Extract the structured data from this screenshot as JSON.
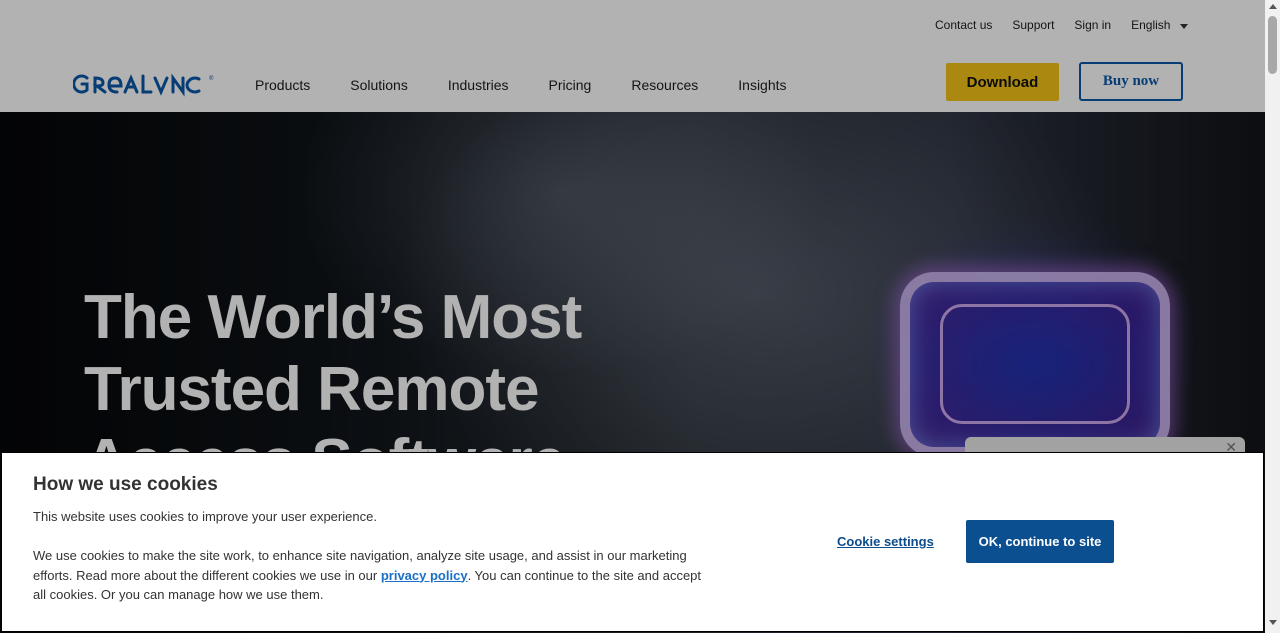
{
  "header": {
    "utility_links": [
      "Contact us",
      "Support",
      "Sign in"
    ],
    "language": "English",
    "logo_text": "REALVNC",
    "nav": [
      "Products",
      "Solutions",
      "Industries",
      "Pricing",
      "Resources",
      "Insights"
    ],
    "download_label": "Download",
    "buy_label": "Buy now"
  },
  "hero": {
    "title": "The World’s Most Trusted Remote Access Software"
  },
  "cookie_banner": {
    "title": "How we use cookies",
    "subtitle": "This website uses cookies to improve your user experience.",
    "body_before_link": "We use cookies to make the site work, to enhance site navigation, analyze site usage, and assist in our marketing efforts. Read more about the different cookies we use in our ",
    "link_text": "privacy policy",
    "body_after_link": ". You can continue to the site and accept all cookies. Or you can manage how we use them.",
    "settings_label": "Cookie settings",
    "ok_label": "OK, continue to site"
  },
  "colors": {
    "brand_blue": "#0b57a8",
    "download_yellow": "#f5c518",
    "ok_button": "#0b4f91"
  },
  "icons": [
    "realvnc-logo",
    "chevron-down-icon",
    "close-icon"
  ]
}
